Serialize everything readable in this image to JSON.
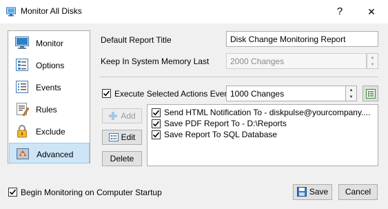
{
  "window": {
    "title": "Monitor All Disks",
    "help_glyph": "?",
    "close_glyph": "✕"
  },
  "sidebar": {
    "items": [
      {
        "label": "Monitor",
        "icon": "monitor-icon"
      },
      {
        "label": "Options",
        "icon": "options-icon"
      },
      {
        "label": "Events",
        "icon": "events-icon"
      },
      {
        "label": "Rules",
        "icon": "rules-icon"
      },
      {
        "label": "Exclude",
        "icon": "lock-icon"
      },
      {
        "label": "Advanced",
        "icon": "advanced-icon",
        "selected": true
      }
    ]
  },
  "form": {
    "report_title_label": "Default Report Title",
    "report_title_value": "Disk Change Monitoring Report",
    "memory_label": "Keep In System Memory Last",
    "memory_value": "2000 Changes",
    "execute_label": "Execute Selected Actions Every",
    "execute_checked": true,
    "execute_value": "1000 Changes"
  },
  "actions": {
    "add_label": "Add",
    "edit_label": "Edit",
    "delete_label": "Delete",
    "items": [
      {
        "label": "Send HTML Notification To - diskpulse@yourcompany....",
        "checked": true
      },
      {
        "label": "Save PDF Report To - D:\\Reports",
        "checked": true
      },
      {
        "label": "Save Report To SQL Database",
        "checked": true
      }
    ]
  },
  "footer": {
    "startup_label": "Begin Monitoring on Computer Startup",
    "startup_checked": true,
    "save_label": "Save",
    "cancel_label": "Cancel"
  },
  "colors": {
    "selected_bg": "#cde6f7",
    "selected_border": "#99c9ef",
    "window_bg": "#f0f0f0"
  }
}
